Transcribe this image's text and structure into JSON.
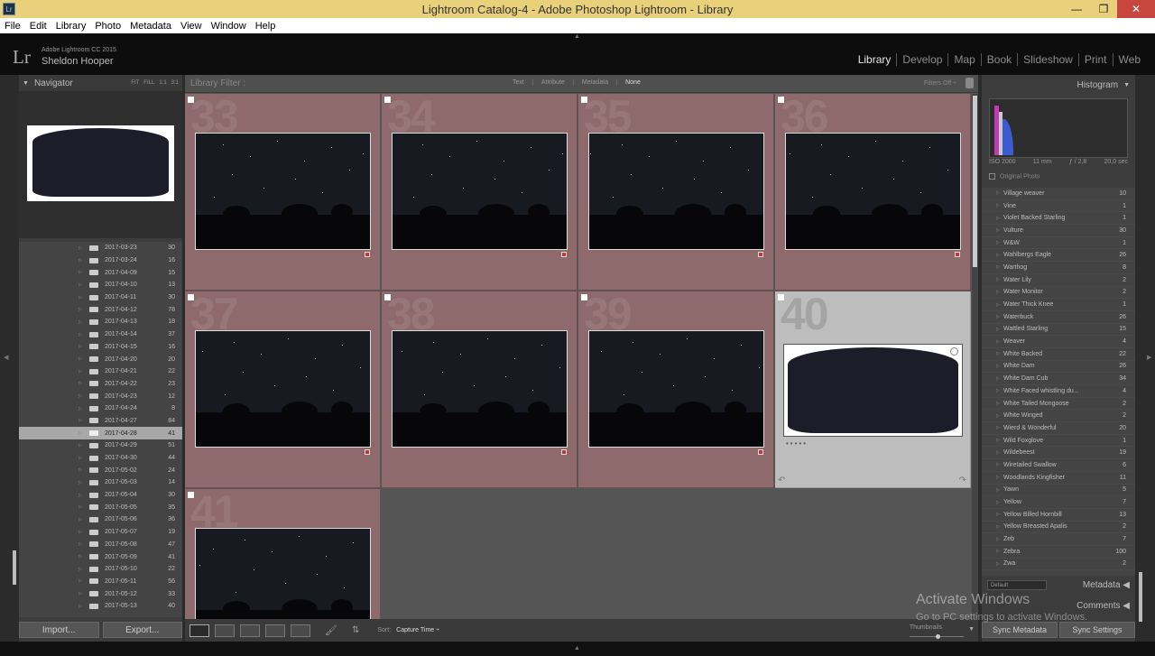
{
  "window": {
    "title": "Lightroom Catalog-4 - Adobe Photoshop Lightroom - Library",
    "app_icon": "Lr",
    "min": "—",
    "max": "❐",
    "close": "✕"
  },
  "menu": [
    "File",
    "Edit",
    "Library",
    "Photo",
    "Metadata",
    "View",
    "Window",
    "Help"
  ],
  "identity": {
    "logo": "Lr",
    "product": "Adobe Lightroom CC 2015",
    "user": "Sheldon Hooper"
  },
  "modules": [
    "Library",
    "Develop",
    "Map",
    "Book",
    "Slideshow",
    "Print",
    "Web"
  ],
  "navigator": {
    "title": "Navigator",
    "options": [
      "FIT",
      "FILL",
      "1:1",
      "3:1"
    ]
  },
  "folders": [
    {
      "date": "2017-03-23",
      "count": "30"
    },
    {
      "date": "2017-03-24",
      "count": "16"
    },
    {
      "date": "2017-04-09",
      "count": "15"
    },
    {
      "date": "2017-04-10",
      "count": "13"
    },
    {
      "date": "2017-04-11",
      "count": "30"
    },
    {
      "date": "2017-04-12",
      "count": "78"
    },
    {
      "date": "2017-04-13",
      "count": "18"
    },
    {
      "date": "2017-04-14",
      "count": "37"
    },
    {
      "date": "2017-04-15",
      "count": "16"
    },
    {
      "date": "2017-04-20",
      "count": "20"
    },
    {
      "date": "2017-04-21",
      "count": "22"
    },
    {
      "date": "2017-04-22",
      "count": "23"
    },
    {
      "date": "2017-04-23",
      "count": "12"
    },
    {
      "date": "2017-04-24",
      "count": "8"
    },
    {
      "date": "2017-04-27",
      "count": "84"
    },
    {
      "date": "2017-04-28",
      "count": "41",
      "selected": true
    },
    {
      "date": "2017-04-29",
      "count": "51"
    },
    {
      "date": "2017-04-30",
      "count": "44"
    },
    {
      "date": "2017-05-02",
      "count": "24"
    },
    {
      "date": "2017-05-03",
      "count": "14"
    },
    {
      "date": "2017-05-04",
      "count": "30"
    },
    {
      "date": "2017-05-05",
      "count": "35"
    },
    {
      "date": "2017-05-06",
      "count": "36"
    },
    {
      "date": "2017-05-07",
      "count": "19"
    },
    {
      "date": "2017-05-08",
      "count": "47"
    },
    {
      "date": "2017-05-09",
      "count": "41"
    },
    {
      "date": "2017-05-10",
      "count": "22"
    },
    {
      "date": "2017-05-11",
      "count": "56"
    },
    {
      "date": "2017-05-12",
      "count": "33"
    },
    {
      "date": "2017-05-13",
      "count": "40"
    }
  ],
  "left_buttons": {
    "import": "Import...",
    "export": "Export..."
  },
  "filter": {
    "label": "Library Filter :",
    "options": [
      "Text",
      "Attribute",
      "Metadata",
      "None"
    ],
    "selected": "None",
    "filters_off": "Filters Off ÷"
  },
  "grid_cells": [
    {
      "num": "33",
      "type": "photo"
    },
    {
      "num": "34",
      "type": "photo"
    },
    {
      "num": "35",
      "type": "photo"
    },
    {
      "num": "36",
      "type": "photo"
    },
    {
      "num": "37",
      "type": "photo"
    },
    {
      "num": "38",
      "type": "photo"
    },
    {
      "num": "39",
      "type": "photo"
    },
    {
      "num": "40",
      "type": "pano",
      "selected": true
    },
    {
      "num": "41",
      "type": "photo"
    }
  ],
  "toolbar": {
    "sort_label": "Sort:",
    "sort_value": "Capture Time ÷",
    "thumbnails_label": "Thumbnails"
  },
  "histogram": {
    "title": "Histogram",
    "iso": "ISO 2000",
    "focal": "11 mm",
    "aperture": "ƒ / 2,8",
    "shutter": "20,0 sec",
    "original_photo": "Original Photo"
  },
  "keywords": [
    {
      "name": "Village weaver",
      "count": "10"
    },
    {
      "name": "Vine",
      "count": "1"
    },
    {
      "name": "Violet Backed Starling",
      "count": "1"
    },
    {
      "name": "Vulture",
      "count": "30"
    },
    {
      "name": "W&W",
      "count": "1"
    },
    {
      "name": "Wahlbergs Eagle",
      "count": "26"
    },
    {
      "name": "Warthog",
      "count": "8"
    },
    {
      "name": "Water Lily",
      "count": "2"
    },
    {
      "name": "Water Monitor",
      "count": "2"
    },
    {
      "name": "Water Thick Knee",
      "count": "1"
    },
    {
      "name": "Waterbuck",
      "count": "26"
    },
    {
      "name": "Wattled Starling",
      "count": "15"
    },
    {
      "name": "Weaver",
      "count": "4"
    },
    {
      "name": "White Backed",
      "count": "22"
    },
    {
      "name": "White Dam",
      "count": "26"
    },
    {
      "name": "White Dam Cub",
      "count": "34"
    },
    {
      "name": "White Faced whistling du...",
      "count": "4"
    },
    {
      "name": "White Tailed Mongoose",
      "count": "2"
    },
    {
      "name": "White Winged",
      "count": "2"
    },
    {
      "name": "Wierd & Wonderful",
      "count": "20"
    },
    {
      "name": "Wild Foxglove",
      "count": "1"
    },
    {
      "name": "Wildebeest",
      "count": "19"
    },
    {
      "name": "Wiretailed Swallow",
      "count": "6"
    },
    {
      "name": "Woodlands Kingfisher",
      "count": "11"
    },
    {
      "name": "Yawn",
      "count": "5"
    },
    {
      "name": "Yellow",
      "count": "7"
    },
    {
      "name": "Yellow Billed Hornbill",
      "count": "13"
    },
    {
      "name": "Yellow Breasted Apalis",
      "count": "2"
    },
    {
      "name": "Zeb",
      "count": "7"
    },
    {
      "name": "Zebra",
      "count": "100"
    },
    {
      "name": "Zwa",
      "count": "2"
    }
  ],
  "metadata": {
    "preset": "Default",
    "title": "Metadata ◀"
  },
  "comments": {
    "title": "Comments ◀"
  },
  "right_buttons": {
    "sync_metadata": "Sync Metadata",
    "sync_settings": "Sync Settings"
  },
  "watermark": {
    "line1": "Activate Windows",
    "line2": "Go to PC settings to activate Windows."
  }
}
